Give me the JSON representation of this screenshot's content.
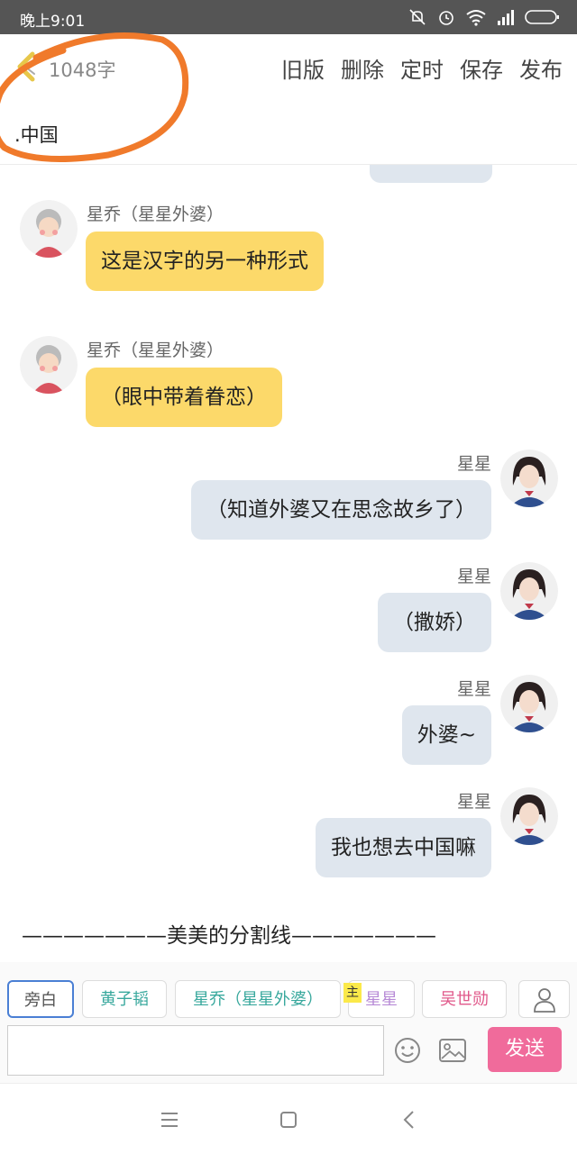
{
  "status": {
    "time": "晚上9:01"
  },
  "header": {
    "word_count": "1048字",
    "actions": [
      "旧版",
      "删除",
      "定时",
      "保存",
      "发布"
    ]
  },
  "title": ".中国",
  "messages": [
    {
      "side": "left",
      "name": "星乔（星星外婆）",
      "text": "这是汉字的另一种形式"
    },
    {
      "side": "left",
      "name": "星乔（星星外婆）",
      "text": "（眼中带着眷恋）"
    },
    {
      "side": "right",
      "name": "星星",
      "text": "（知道外婆又在思念故乡了）"
    },
    {
      "side": "right",
      "name": "星星",
      "text": "（撒娇）"
    },
    {
      "side": "right",
      "name": "星星",
      "text": "外婆~"
    },
    {
      "side": "right",
      "name": "星星",
      "text": "我也想去中国嘛"
    }
  ],
  "divider_text": "———————美美的分割线———————",
  "characters": [
    {
      "label": "旁白",
      "color": "#555555",
      "active": true
    },
    {
      "label": "黄子韬",
      "color": "#38a89d",
      "active": false
    },
    {
      "label": "星乔（星星外婆）",
      "color": "#38a89d",
      "active": false
    },
    {
      "label": "星星",
      "color": "#b78ad6",
      "active": false
    },
    {
      "label": "吴世勋",
      "color": "#e0588a",
      "active": false
    }
  ],
  "master_badge": "主",
  "input": {
    "value": "",
    "send_label": "发送"
  },
  "colors": {
    "left_bubble": "#fcd96a",
    "right_bubble": "#dfe6ee",
    "send_button": "#f06b9b",
    "annotation_circle": "#f07a2b"
  }
}
